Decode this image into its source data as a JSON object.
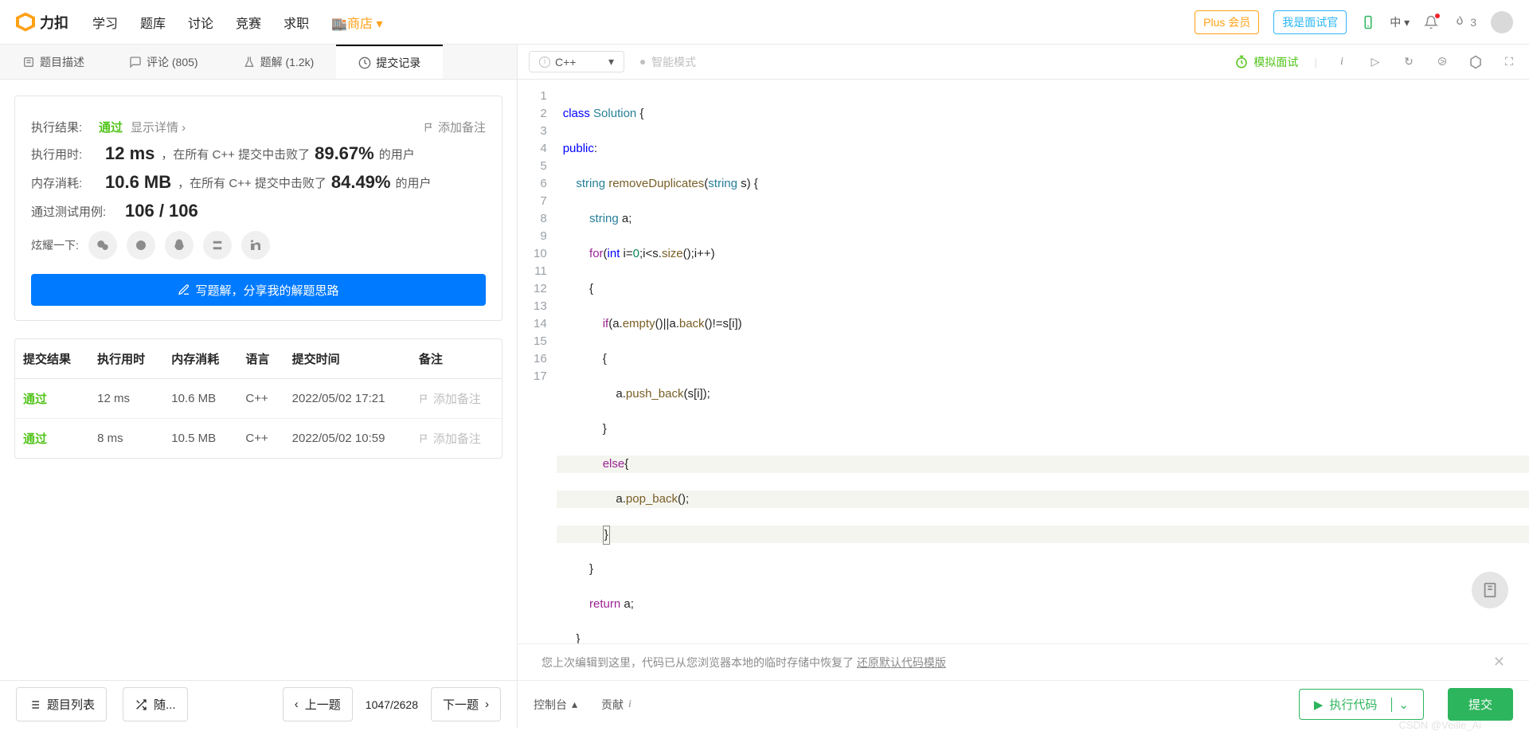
{
  "brand": "力扣",
  "nav": {
    "learn": "学习",
    "problems": "题库",
    "discuss": "讨论",
    "contest": "竞赛",
    "jobs": "求职",
    "store": "商店"
  },
  "header": {
    "plus": "Plus 会员",
    "interviewer": "我是面试官",
    "lang": "中",
    "streak": "3"
  },
  "left_tabs": {
    "desc": "题目描述",
    "comments": "评论 (805)",
    "solutions": "题解 (1.2k)",
    "submissions": "提交记录"
  },
  "result": {
    "exec_label": "执行结果:",
    "status": "通过",
    "show_detail": "显示详情 ›",
    "add_note": "添加备注",
    "time_label": "执行用时:",
    "time": "12 ms",
    "time_desc_a": "，在所有 C++ 提交中击败了",
    "time_pct": "89.67%",
    "time_desc_b": "的用户",
    "mem_label": "内存消耗:",
    "mem": "10.6 MB",
    "mem_desc_a": "，在所有 C++ 提交中击败了",
    "mem_pct": "84.49%",
    "mem_desc_b": "的用户",
    "cases_label": "通过测试用例:",
    "cases": "106 / 106",
    "brag": "炫耀一下:",
    "write": "写题解，分享我的解题思路"
  },
  "hist": {
    "h_result": "提交结果",
    "h_time": "执行用时",
    "h_mem": "内存消耗",
    "h_lang": "语言",
    "h_when": "提交时间",
    "h_note": "备注",
    "rows": [
      {
        "r": "通过",
        "t": "12 ms",
        "m": "10.6 MB",
        "l": "C++",
        "w": "2022/05/02 17:21",
        "n": "添加备注"
      },
      {
        "r": "通过",
        "t": "8 ms",
        "m": "10.5 MB",
        "l": "C++",
        "w": "2022/05/02 10:59",
        "n": "添加备注"
      }
    ]
  },
  "footer_left": {
    "list": "题目列表",
    "random": "随...",
    "prev": "上一题",
    "progress": "1047/2628",
    "next": "下一题"
  },
  "editor": {
    "lang": "C++",
    "smart": "智能模式",
    "mock": "模拟面试"
  },
  "code": {
    "l1": "class Solution {",
    "l2": "public:",
    "l3": "    string removeDuplicates(string s) {",
    "l4": "        string a;",
    "l5": "        for(int i=0;i<s.size();i++)",
    "l6": "        {",
    "l7": "            if(a.empty()||a.back()!=s[i])",
    "l8": "            {",
    "l9": "                a.push_back(s[i]);",
    "l10": "            }",
    "l11a": "            ",
    "l11b": "else",
    "l11c": "{",
    "l12": "                a.pop_back();",
    "l13a": "            ",
    "l13b": "}",
    "l14": "        }",
    "l15": "        return a;",
    "l16": "    }",
    "l17": "};"
  },
  "notice": {
    "text": "您上次编辑到这里，代码已从您浏览器本地的临时存储中恢复了",
    "restore": "还原默认代码模版"
  },
  "footer_right": {
    "console": "控制台",
    "contrib": "贡献",
    "run": "执行代码",
    "submit": "提交"
  },
  "watermark": "CSDN @Veille_Ai"
}
